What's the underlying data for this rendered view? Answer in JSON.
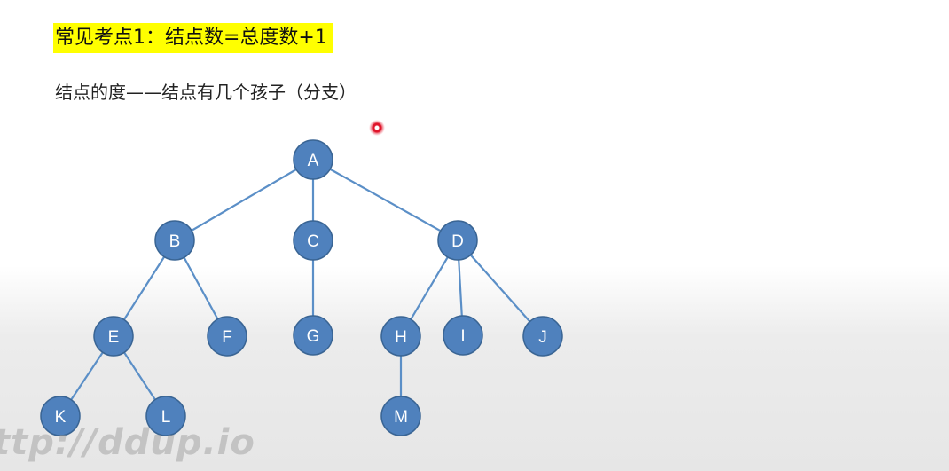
{
  "title": "常见考点1：结点数=总度数+1",
  "subtitle": "结点的度——结点有几个孩子（分支）",
  "watermark": "ttp://ddup.io",
  "colors": {
    "highlight": "#ffff00",
    "node_fill": "#4f81bd",
    "node_stroke": "#3a6594",
    "edge": "#5b8fc7",
    "cursor": "#e0142a"
  },
  "tree": {
    "nodes": [
      "A",
      "B",
      "C",
      "D",
      "E",
      "F",
      "G",
      "H",
      "I",
      "J",
      "K",
      "L",
      "M"
    ],
    "edges": [
      [
        "A",
        "B"
      ],
      [
        "A",
        "C"
      ],
      [
        "A",
        "D"
      ],
      [
        "B",
        "E"
      ],
      [
        "B",
        "F"
      ],
      [
        "C",
        "G"
      ],
      [
        "D",
        "H"
      ],
      [
        "D",
        "I"
      ],
      [
        "D",
        "J"
      ],
      [
        "E",
        "K"
      ],
      [
        "E",
        "L"
      ],
      [
        "H",
        "M"
      ]
    ]
  }
}
